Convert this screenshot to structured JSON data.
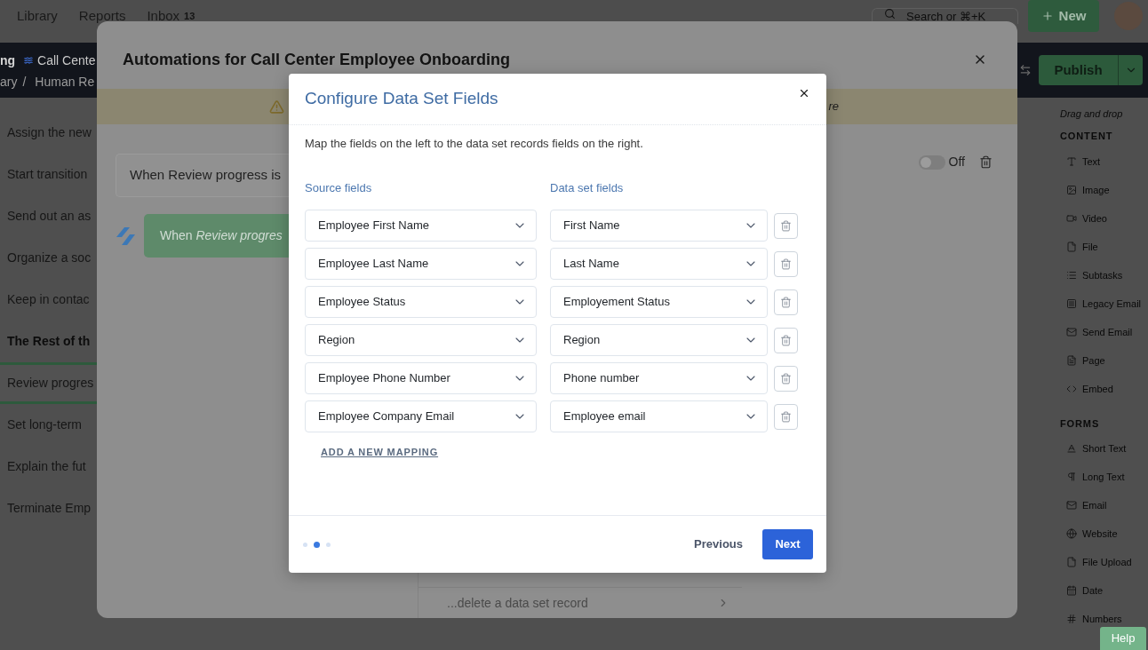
{
  "top_nav": {
    "links": [
      {
        "label": "Library"
      },
      {
        "label": "Reports"
      },
      {
        "label": "Inbox",
        "badge": "13"
      }
    ],
    "search": {
      "placeholder": "Search or ⌘+K"
    },
    "new_button": {
      "label": "New"
    }
  },
  "workflow_header": {
    "title_start": "ng",
    "title": "Call Cente",
    "breadcrumb": {
      "items": [
        "ary",
        "Human Re"
      ],
      "separator": "/"
    },
    "publish_button": {
      "label": "Publish"
    }
  },
  "task_list": [
    {
      "kind": "task",
      "label": "Assign the new",
      "selected": false
    },
    {
      "kind": "task",
      "label": "Start transition",
      "selected": false
    },
    {
      "kind": "task",
      "label": "Send out an as",
      "selected": false
    },
    {
      "kind": "task",
      "label": "Organize a soc",
      "selected": false
    },
    {
      "kind": "task",
      "label": "Keep in contac",
      "selected": false
    },
    {
      "kind": "heading",
      "label": "The Rest of th",
      "selected": false
    },
    {
      "kind": "task",
      "label": "Review progres",
      "selected": true
    },
    {
      "kind": "task",
      "label": "Set long-term",
      "selected": false
    },
    {
      "kind": "task",
      "label": "Explain the fut",
      "selected": false
    },
    {
      "kind": "task",
      "label": "Terminate Emp",
      "selected": false
    }
  ],
  "sidebar": {
    "hint": "Drag and drop",
    "sections": [
      {
        "title": "CONTENT",
        "items": [
          "Text",
          "Image",
          "Video",
          "File",
          "Subtasks",
          "Legacy Email",
          "Send Email",
          "Page",
          "Embed"
        ]
      },
      {
        "title": "FORMS",
        "items": [
          "Short Text",
          "Long Text",
          "Email",
          "Website",
          "File Upload",
          "Date",
          "Numbers"
        ]
      }
    ]
  },
  "help_button": {
    "label": "Help"
  },
  "automations": {
    "title": "Automations for Call Center Employee Onboarding",
    "warning": "re",
    "trigger": "When Review progress is",
    "toggle": {
      "label": "Off",
      "on": false
    },
    "rule": "When *Review progres*",
    "action": "...delete a data set record"
  },
  "dialog": {
    "title": "Configure Data Set Fields",
    "description": "Map the fields on the left to the data set records fields on the right.",
    "columns": [
      "Source fields",
      "Data set fields"
    ],
    "mappings": [
      {
        "source": "Employee First Name",
        "target": "First Name"
      },
      {
        "source": "Employee Last Name",
        "target": "Last Name"
      },
      {
        "source": "Employee Status",
        "target": "Employement Status"
      },
      {
        "source": "Region",
        "target": "Region"
      },
      {
        "source": "Employee Phone Number",
        "target": "Phone number"
      },
      {
        "source": "Employee Company Email",
        "target": "Employee email"
      }
    ],
    "add_link": "ADD A NEW MAPPING",
    "steps": [
      {
        "selected": false
      },
      {
        "selected": true
      },
      {
        "selected": false
      }
    ],
    "previous_button": "Previous",
    "next_button": "Next"
  }
}
